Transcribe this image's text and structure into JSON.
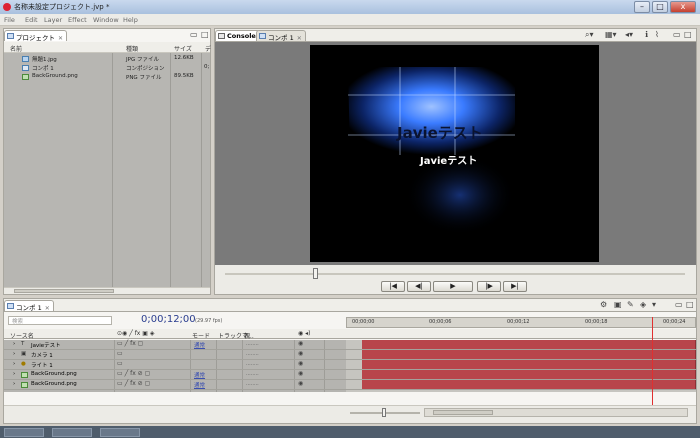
{
  "window": {
    "title": "名称未設定プロジェクト.jvp *"
  },
  "menu": [
    "File",
    "Edit",
    "Layer",
    "Effect",
    "Window",
    "Help"
  ],
  "project_panel": {
    "tab": "プロジェクト",
    "columns": [
      "名前",
      "種類",
      "サイズ"
    ],
    "col_extra": "デ",
    "items": [
      {
        "name": "無題1.jpg",
        "type": "JPG ファイル",
        "size": "12.6KB",
        "extra": ""
      },
      {
        "name": "コンポ 1",
        "type": "コンポジション",
        "size": "",
        "extra": "0;"
      },
      {
        "name": "BackGround.png",
        "type": "PNG ファイル",
        "size": "89.5KB",
        "extra": ""
      }
    ]
  },
  "viewer_panel": {
    "tabs": [
      "Console",
      "コンポ 1"
    ],
    "preview_text_large": "Javieテスト",
    "preview_text_small": "Javieテスト",
    "transport": [
      "|◀",
      "◀|",
      "▶",
      "|▶",
      "▶|"
    ]
  },
  "timeline_panel": {
    "tab": "コンポ 1",
    "search_placeholder": "検索",
    "timecode": "0;00;12;00",
    "fps": "(29.97 fps)",
    "columns": {
      "source": "ソース名",
      "mode": "モード",
      "track": "トラックマ...",
      "parent": "親"
    },
    "ruler": [
      "00;00;00",
      "00;00;06",
      "00;00;12",
      "00;00;18",
      "00;00;24"
    ],
    "layers": [
      {
        "name": "Javieテスト",
        "mode": "通常",
        "parent": "........"
      },
      {
        "name": "カメラ 1",
        "mode": "",
        "parent": "........"
      },
      {
        "name": "ライト 1",
        "mode": "",
        "parent": "........"
      },
      {
        "name": "BackGround.png",
        "mode": "通常",
        "parent": "........"
      },
      {
        "name": "BackGround.png",
        "mode": "通常",
        "parent": "........"
      }
    ]
  },
  "colors": {
    "accent": "#2f6fe0",
    "layer_bar": "#b8454b",
    "playhead": "#e03030"
  }
}
